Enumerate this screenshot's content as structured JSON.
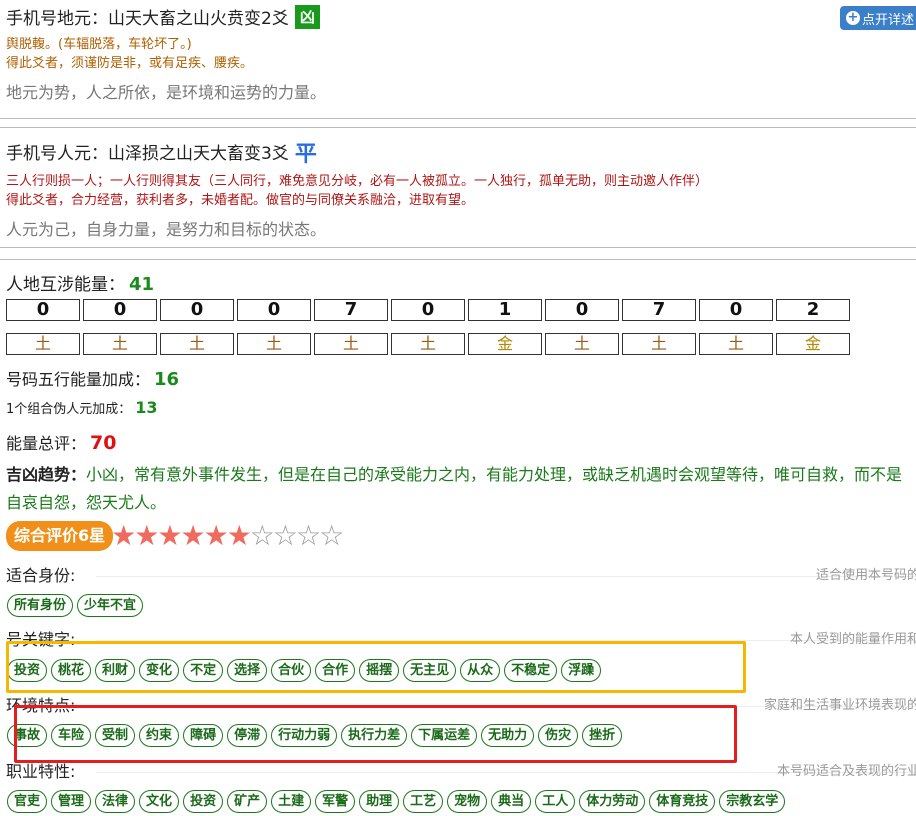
{
  "add_button": {
    "label": "点开详述"
  },
  "earth": {
    "title": "手机号地元：山天大畜之山火贲变2爻",
    "verdict": "凶",
    "line1": "舆脱輹。(车辐脱落，车轮坏了。)",
    "line2": "得此爻者，须谨防是非，或有足疾、腰疾。",
    "summary": "地元为势，人之所依，是环境和运势的力量。"
  },
  "human": {
    "title": "手机号人元：山泽损之山天大畜变3爻",
    "verdict": "平",
    "line1": "三人行则损一人；一人行则得其友（三人同行，难免意见分岐，必有一人被孤立。一人独行，孤单无助，则主动邀人作伴）",
    "line2": "得此爻者，合力经营，获利者多，未婚者配。做官的与同僚关系融洽，进取有望。",
    "summary": "人元为己，自身力量，是努力和目标的状态。"
  },
  "energy": {
    "label": "人地互涉能量：",
    "value": "41",
    "digits": [
      "0",
      "0",
      "0",
      "0",
      "7",
      "0",
      "1",
      "0",
      "7",
      "0",
      "2"
    ],
    "elements": [
      "土",
      "土",
      "土",
      "土",
      "土",
      "土",
      "金",
      "土",
      "土",
      "土",
      "金"
    ],
    "element_colors": {
      "土": "#9a5a10",
      "金": "#b08a00"
    }
  },
  "wuxing_bonus": {
    "label": "号码五行能量加成：",
    "value": "16"
  },
  "combo_bonus": {
    "label": "1个组合伪人元加成：",
    "value": "13"
  },
  "total": {
    "label": "能量总评：",
    "value": "70"
  },
  "fortune": {
    "label": "吉凶趋势：",
    "text": "小凶，常有意外事件发生，但是在自己的承受能力之内，有能力处理，或缺乏机遇时会观望等待，唯可自救，而不是自哀自怨，怨天尤人。"
  },
  "rating": {
    "label": "综合评价6星",
    "stars": 6,
    "max_stars": 10
  },
  "categories": [
    {
      "label": "适合身份:",
      "desc": "适合使用本号码的人群",
      "tags": [
        "所有身份",
        "少年不宜"
      ]
    },
    {
      "label": "号关键字:",
      "desc": "本人受到的能量作用和体现",
      "tags": [
        "投资",
        "桃花",
        "利财",
        "变化",
        "不定",
        "选择",
        "合伙",
        "合作",
        "摇摆",
        "无主见",
        "从众",
        "不稳定",
        "浮躁"
      ]
    },
    {
      "label": "环境特点:",
      "desc": "家庭和生活事业环境表现的特点",
      "tags": [
        "事故",
        "车险",
        "受制",
        "约束",
        "障碍",
        "停滞",
        "行动力弱",
        "执行力差",
        "下属运差",
        "无助力",
        "伤灾",
        "挫折"
      ]
    },
    {
      "label": "职业特性:",
      "desc": "本号码适合及表现的行业特性",
      "tags": [
        "官吏",
        "管理",
        "法律",
        "文化",
        "投资",
        "矿产",
        "土建",
        "军警",
        "助理",
        "工艺",
        "宠物",
        "典当",
        "工人",
        "体力劳动",
        "体育竞技",
        "宗教玄学"
      ]
    }
  ]
}
